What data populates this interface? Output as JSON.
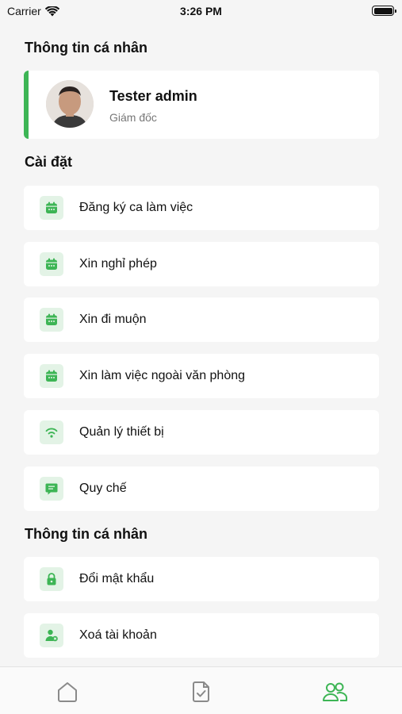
{
  "status_bar": {
    "carrier": "Carrier",
    "time": "3:26 PM"
  },
  "personal_section": {
    "title": "Thông tin cá nhân"
  },
  "profile": {
    "name": "Tester admin",
    "role": "Giám đốc"
  },
  "settings_section": {
    "title": "Cài đặt",
    "items": [
      {
        "label": "Đăng ký ca làm việc",
        "icon": "calendar-icon"
      },
      {
        "label": "Xin nghỉ phép",
        "icon": "calendar-icon"
      },
      {
        "label": "Xin đi muộn",
        "icon": "calendar-icon"
      },
      {
        "label": "Xin làm việc ngoài văn phòng",
        "icon": "calendar-icon"
      },
      {
        "label": "Quản lý thiết bị",
        "icon": "wifi-icon"
      },
      {
        "label": "Quy chế",
        "icon": "document-icon"
      }
    ]
  },
  "account_section": {
    "title": "Thông tin cá nhân",
    "items": [
      {
        "label": "Đổi mật khẩu",
        "icon": "lock-icon"
      },
      {
        "label": "Xoá tài khoản",
        "icon": "user-delete-icon"
      }
    ]
  },
  "tab_bar": {
    "tabs": [
      {
        "name": "home",
        "icon": "home-icon",
        "active": false
      },
      {
        "name": "documents",
        "icon": "document-check-icon",
        "active": false
      },
      {
        "name": "people",
        "icon": "users-icon",
        "active": true
      }
    ]
  },
  "colors": {
    "accent": "#3db555",
    "icon_bg": "#e3f3e6",
    "tab_inactive": "#8a8a8a"
  }
}
